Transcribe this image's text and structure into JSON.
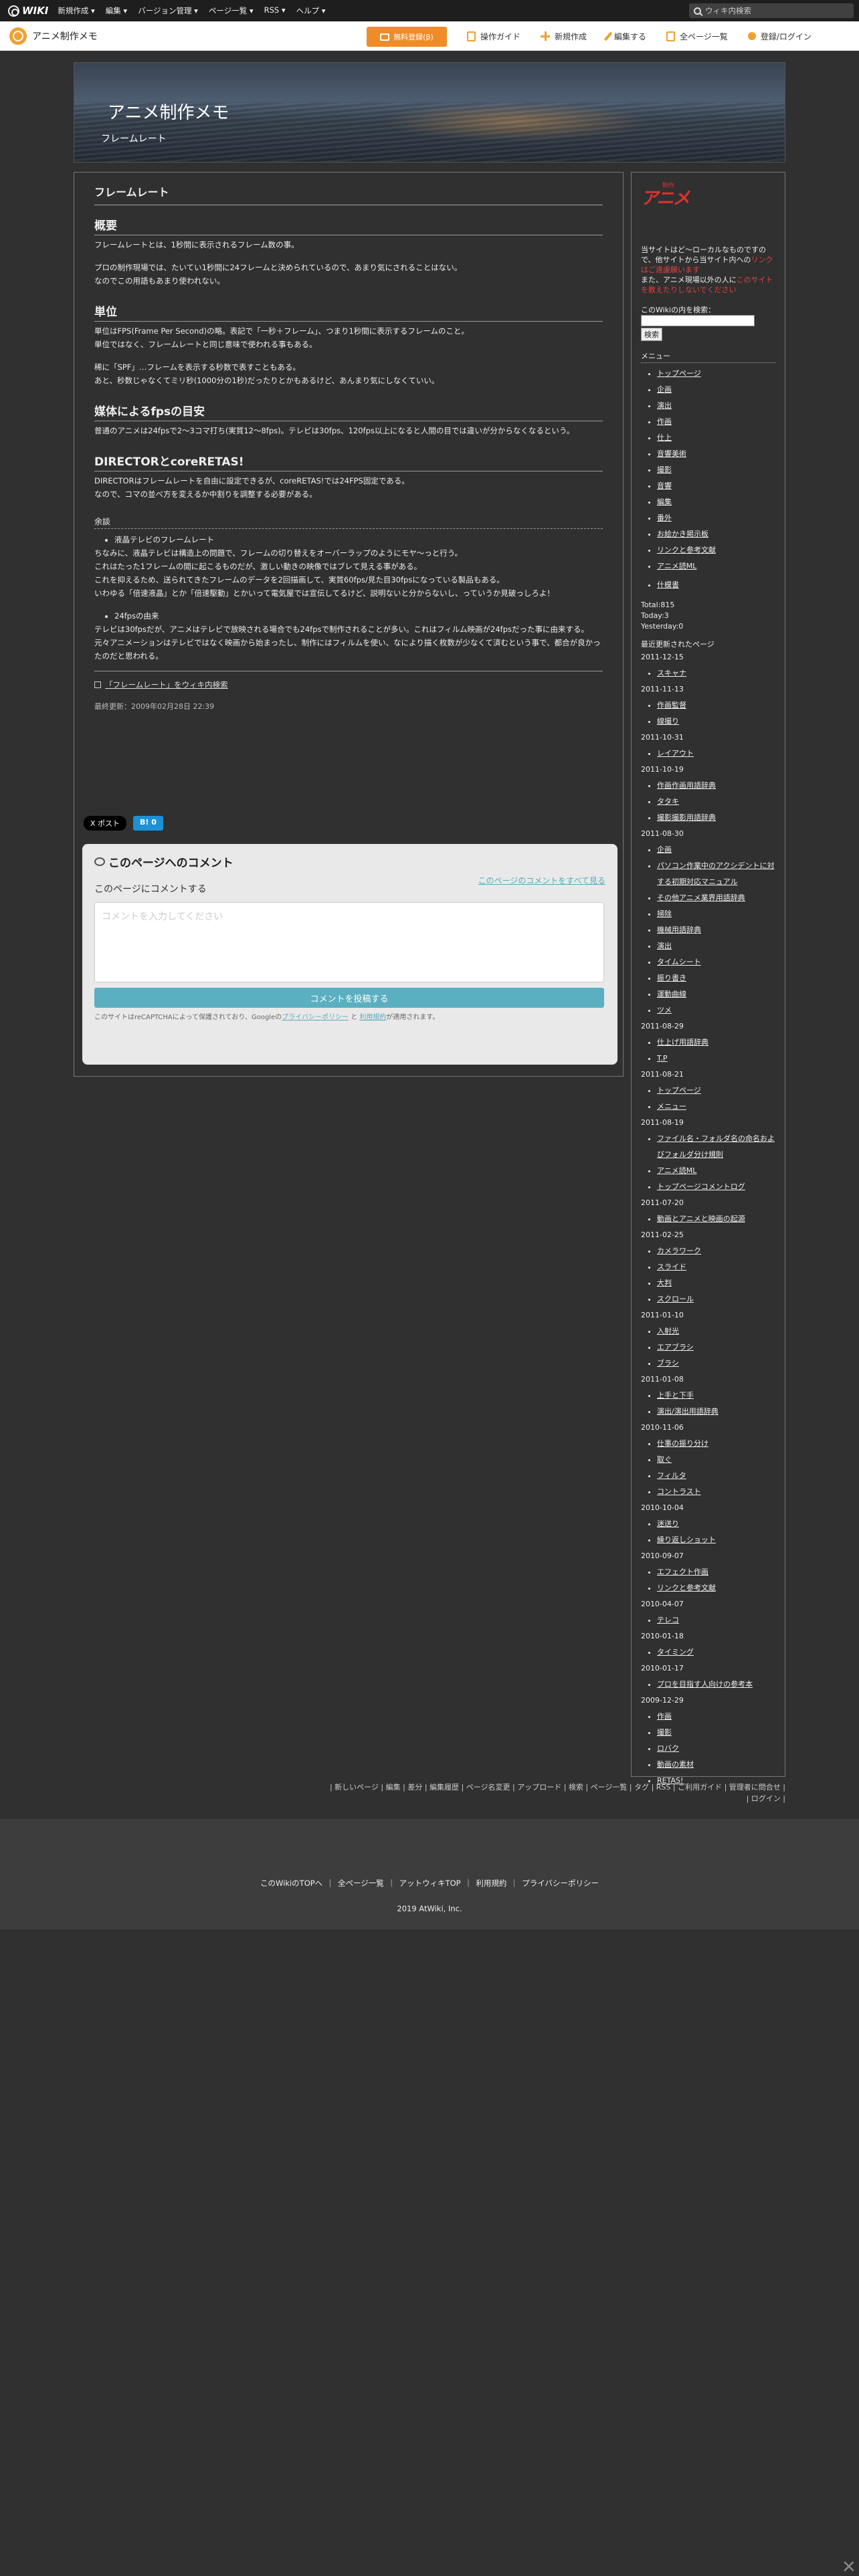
{
  "topbar": {
    "logo": "WIKI",
    "menu": [
      "新規作成 ▾",
      "編集 ▾",
      "バージョン管理 ▾",
      "ページ一覧 ▾",
      "RSS ▾",
      "ヘルプ ▾"
    ],
    "search_placeholder": "ウィキ内検索"
  },
  "site": {
    "name": "アニメ制作メモ",
    "free_signup": "無料登録(β)",
    "actions": [
      "操作ガイド",
      "新規作成",
      "編集する",
      "全ページ一覧",
      "登録/ログイン"
    ]
  },
  "header": {
    "title": "アニメ制作メモ",
    "subtitle": "フレームレート"
  },
  "page": {
    "title": "フレームレート",
    "s1_heading": "概要",
    "s1_p1": "フレームレートとは、1秒間に表示されるフレーム数の事。",
    "s1_p2": "プロの制作現場では、たいてい1秒間に24フレームと決められているので、あまり気にされることはない。",
    "s1_p3": "なのでこの用語もあまり使われない。",
    "s2_heading": "単位",
    "s2_p1": "単位はFPS(Frame Per Second)の略。表記で「一秒＋フレーム」、つまり1秒間に表示するフレームのこと。",
    "s2_p2": "単位ではなく、フレームレートと同じ意味で使われる事もある。",
    "s2_p3": "稀に「SPF」…フレームを表示する秒数で表すこともある。",
    "s2_p4": "あと、秒数じゃなくてミリ秒(1000分の1秒)だったりとかもあるけど、あんまり気にしなくていい。",
    "s3_heading": "媒体によるfpsの目安",
    "s3_p1": "普通のアニメは24fpsで2〜3コマ打ち(実質12〜8fps)。テレビは30fps、120fps以上になると人間の目では違いが分からなくなるという。",
    "s4_heading": "DIRECTORとcoreRETAS!",
    "s4_p1": "DIRECTORはフレームレートを自由に設定できるが、coreRETAS!では24FPS固定である。",
    "s4_p2": "なので、コマの並べ方を変えるか中割りを調整する必要がある。",
    "misc_heading": "余談",
    "misc_item1": "液晶テレビのフレームレート",
    "misc_p1": "ちなみに、液晶テレビは構造上の問題で、フレームの切り替えをオーバーラップのようにモヤ〜っと行う。",
    "misc_p2": "これはたった1フレームの間に起こるものだが、激しい動きの映像ではブレて見える事がある。",
    "misc_p3": "これを抑えるため、送られてきたフレームのデータを2回描画して、実質60fps/見た目30fpsになっている製品もある。",
    "misc_p4": "いわゆる「倍速液晶」とか「倍速駆動」とかいって電気屋では宣伝してるけど、説明ないと分からないし、っていうか見破っしろよ！",
    "misc_item2": "24fpsの由来",
    "misc_p5": "テレビは30fpsだが、アニメはテレビで放映される場合でも24fpsで制作されることが多い。これはフィルム映画が24fpsだった事に由来する。",
    "misc_p6": "元々アニメーションはテレビではなく映画から始まったし、制作にはフィルムを使い、なにより描く枚数が少なくて済むという事で、都合が良かったのだと思われる。",
    "ext_link": "「フレームレート」をウィキ内検索",
    "last_modified": "最終更新：2009年02月28日 22:39"
  },
  "social": {
    "x": "X ポスト",
    "hatena": "B! 0"
  },
  "comments": {
    "title": "このページへのコメント",
    "see_all": "このページのコメントをすべて見る",
    "subheading": "このページにコメントする",
    "placeholder": "コメントを入力してください",
    "submit": "コメントを投稿する",
    "recaptcha_a": "このサイトはreCAPTCHAによって保護されており、Googleの",
    "privacy": "プライバシーポリシー",
    "and": "と",
    "terms": "利用規約",
    "recaptcha_b": "が適用されます。"
  },
  "sidebar": {
    "logo_text": "アニメ",
    "logo_tiny": "制作",
    "intro_a": "当サイトはど〜ローカルなものですので、他サイトから当サイト内への",
    "intro_link1": "リンクはご遠慮願います",
    "intro_b": "また、アニメ現場以外の人に",
    "intro_link2": "このサイトを教えたりしないでください",
    "search_label": "このWikiの内を検索：",
    "search_button": "検索",
    "menu_heading": "メニュー",
    "menu": [
      "トップページ",
      "企画",
      "演出",
      "作画",
      "仕上",
      "音響美術",
      "撮影",
      "音響",
      "編集",
      "番外",
      "お絵かき掲示板",
      "リンクと参考文献",
      "アニメ読ML"
    ],
    "menu_extra": "什模書",
    "stats": [
      "Total:815",
      "Today:3",
      "Yesterday:0"
    ],
    "updates_heading": "最近更新されたページ",
    "updates": [
      {
        "date": "2011-12-15",
        "pages": [
          "スキャナ"
        ]
      },
      {
        "date": "2011-11-13",
        "pages": [
          "作画監督",
          "線撮り"
        ]
      },
      {
        "date": "2011-10-31",
        "pages": [
          "レイアウト"
        ]
      },
      {
        "date": "2011-10-19",
        "pages": [
          "作画作画用語辞典",
          "タタキ",
          "撮影撮影用語辞典"
        ]
      },
      {
        "date": "2011-08-30",
        "pages": [
          "企画",
          "パソコン作業中のアクシデントに対する初期対応マニュアル",
          "その他アニメ業界用語辞典",
          "掃除",
          "機械用語辞典",
          "演出",
          "タイムシート",
          "振り書き",
          "運動曲線",
          "ツメ"
        ]
      },
      {
        "date": "2011-08-29",
        "pages": [
          "仕上げ用語辞典",
          "T.P"
        ]
      },
      {
        "date": "2011-08-21",
        "pages": [
          "トップページ",
          "メニュー"
        ]
      },
      {
        "date": "2011-08-19",
        "pages": [
          "ファイル名・フォルダ名の命名およびフォルダ分け規則",
          "アニメ読ML",
          "トップページコメントログ"
        ]
      },
      {
        "date": "2011-07-20",
        "pages": [
          "動画とアニメと映画の起源"
        ]
      },
      {
        "date": "2011-02-25",
        "pages": [
          "カメラワーク",
          "スライド",
          "大判",
          "スクロール"
        ]
      },
      {
        "date": "2011-01-10",
        "pages": [
          "入射光",
          "エアブラシ",
          "ブラシ"
        ]
      },
      {
        "date": "2011-01-08",
        "pages": [
          "上手と下手",
          "演出/演出用語辞典"
        ]
      },
      {
        "date": "2010-11-06",
        "pages": [
          "仕事の振り分け",
          "取ぐ",
          "フィルタ",
          "コントラスト"
        ]
      },
      {
        "date": "2010-10-04",
        "pages": [
          "迷送り",
          "繰り返しショット"
        ]
      },
      {
        "date": "2010-09-07",
        "pages": [
          "エフェクト作画",
          "リンクと参考文献"
        ]
      },
      {
        "date": "2010-04-07",
        "pages": [
          "テレコ"
        ]
      },
      {
        "date": "2010-01-18",
        "pages": [
          "タイミング"
        ]
      },
      {
        "date": "2010-01-17",
        "pages": [
          "プロを目指す人向けの参考本"
        ]
      },
      {
        "date": "2009-12-29",
        "pages": [
          "作画",
          "撮影",
          "ロバク",
          "動画の素材",
          "RETAS!"
        ]
      }
    ]
  },
  "pagenav": {
    "line1": "| 新しいページ | 編集 | 差分 | 編集履歴 | ページ名変更 | アップロード | 検索 | ページ一覧 | タグ | RSS | ご利用ガイド | 管理者に問合せ |",
    "line2": "| ログイン |"
  },
  "footer": {
    "links": "このWikiのTOPへ ｜ 全ページ一覧 ｜ アットウィキTOP ｜ 利用規約 ｜ プライバシーポリシー",
    "copyright": "2019 AtWiki, Inc."
  },
  "close": "✕"
}
